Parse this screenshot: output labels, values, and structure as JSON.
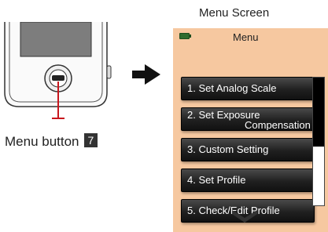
{
  "left_panel": {
    "menu_button_label": "Menu button",
    "menu_button_number": "7"
  },
  "screen": {
    "caption": "Menu Screen",
    "heading": "Menu",
    "items": [
      {
        "line1": "1. Set Analog Scale",
        "line2": ""
      },
      {
        "line1": "2. Set Exposure",
        "line2": "Compensation"
      },
      {
        "line1": "3. Custom Setting",
        "line2": ""
      },
      {
        "line1": "4. Set Profile",
        "line2": ""
      },
      {
        "line1": "5. Check/Edit Profile",
        "line2": ""
      }
    ],
    "scroll_position": 0.0
  },
  "colors": {
    "screen_bg": "#f6c8a0",
    "callout": "#c8161d",
    "button": "#1a1a1a"
  }
}
